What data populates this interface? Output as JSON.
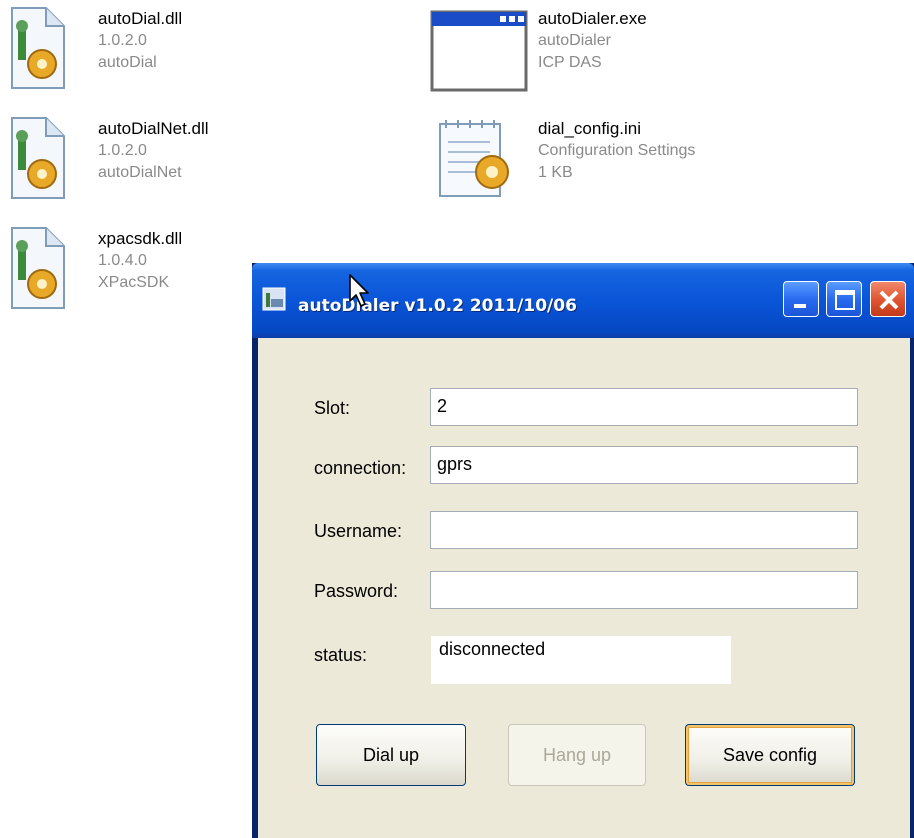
{
  "desktop": {
    "files": [
      {
        "name": "autoDial.dll",
        "line1": "1.0.2.0",
        "line2": "autoDial",
        "icon": "dll-gear-icon"
      },
      {
        "name": "autoDialNet.dll",
        "line1": "1.0.2.0",
        "line2": "autoDialNet",
        "icon": "dll-gear-icon"
      },
      {
        "name": "xpacsdk.dll",
        "line1": "1.0.4.0",
        "line2": "XPacSDK",
        "icon": "dll-gear-icon"
      },
      {
        "name": "autoDialer.exe",
        "line1": "autoDialer",
        "line2": "ICP DAS",
        "icon": "exe-window-icon"
      },
      {
        "name": "dial_config.ini",
        "line1": "Configuration Settings",
        "line2": "1 KB",
        "icon": "ini-config-icon"
      }
    ]
  },
  "window": {
    "title": "autoDialer v1.0.2 2011/10/06",
    "icon": "app-icon",
    "controls": {
      "minimize": "minimize-icon",
      "maximize": "maximize-icon",
      "close": "close-icon"
    }
  },
  "form": {
    "slot_label": "Slot:",
    "slot_value": "2",
    "connection_label": "connection:",
    "connection_value": "gprs",
    "username_label": "Username:",
    "username_value": "",
    "password_label": "Password:",
    "password_value": "",
    "status_label": "status:",
    "status_value": "disconnected"
  },
  "buttons": {
    "dial": "Dial up",
    "hang": "Hang up",
    "save": "Save config"
  },
  "colors": {
    "titlebar": "#0a55d8",
    "client": "#ece9d8",
    "disabled_text": "#aca899"
  }
}
